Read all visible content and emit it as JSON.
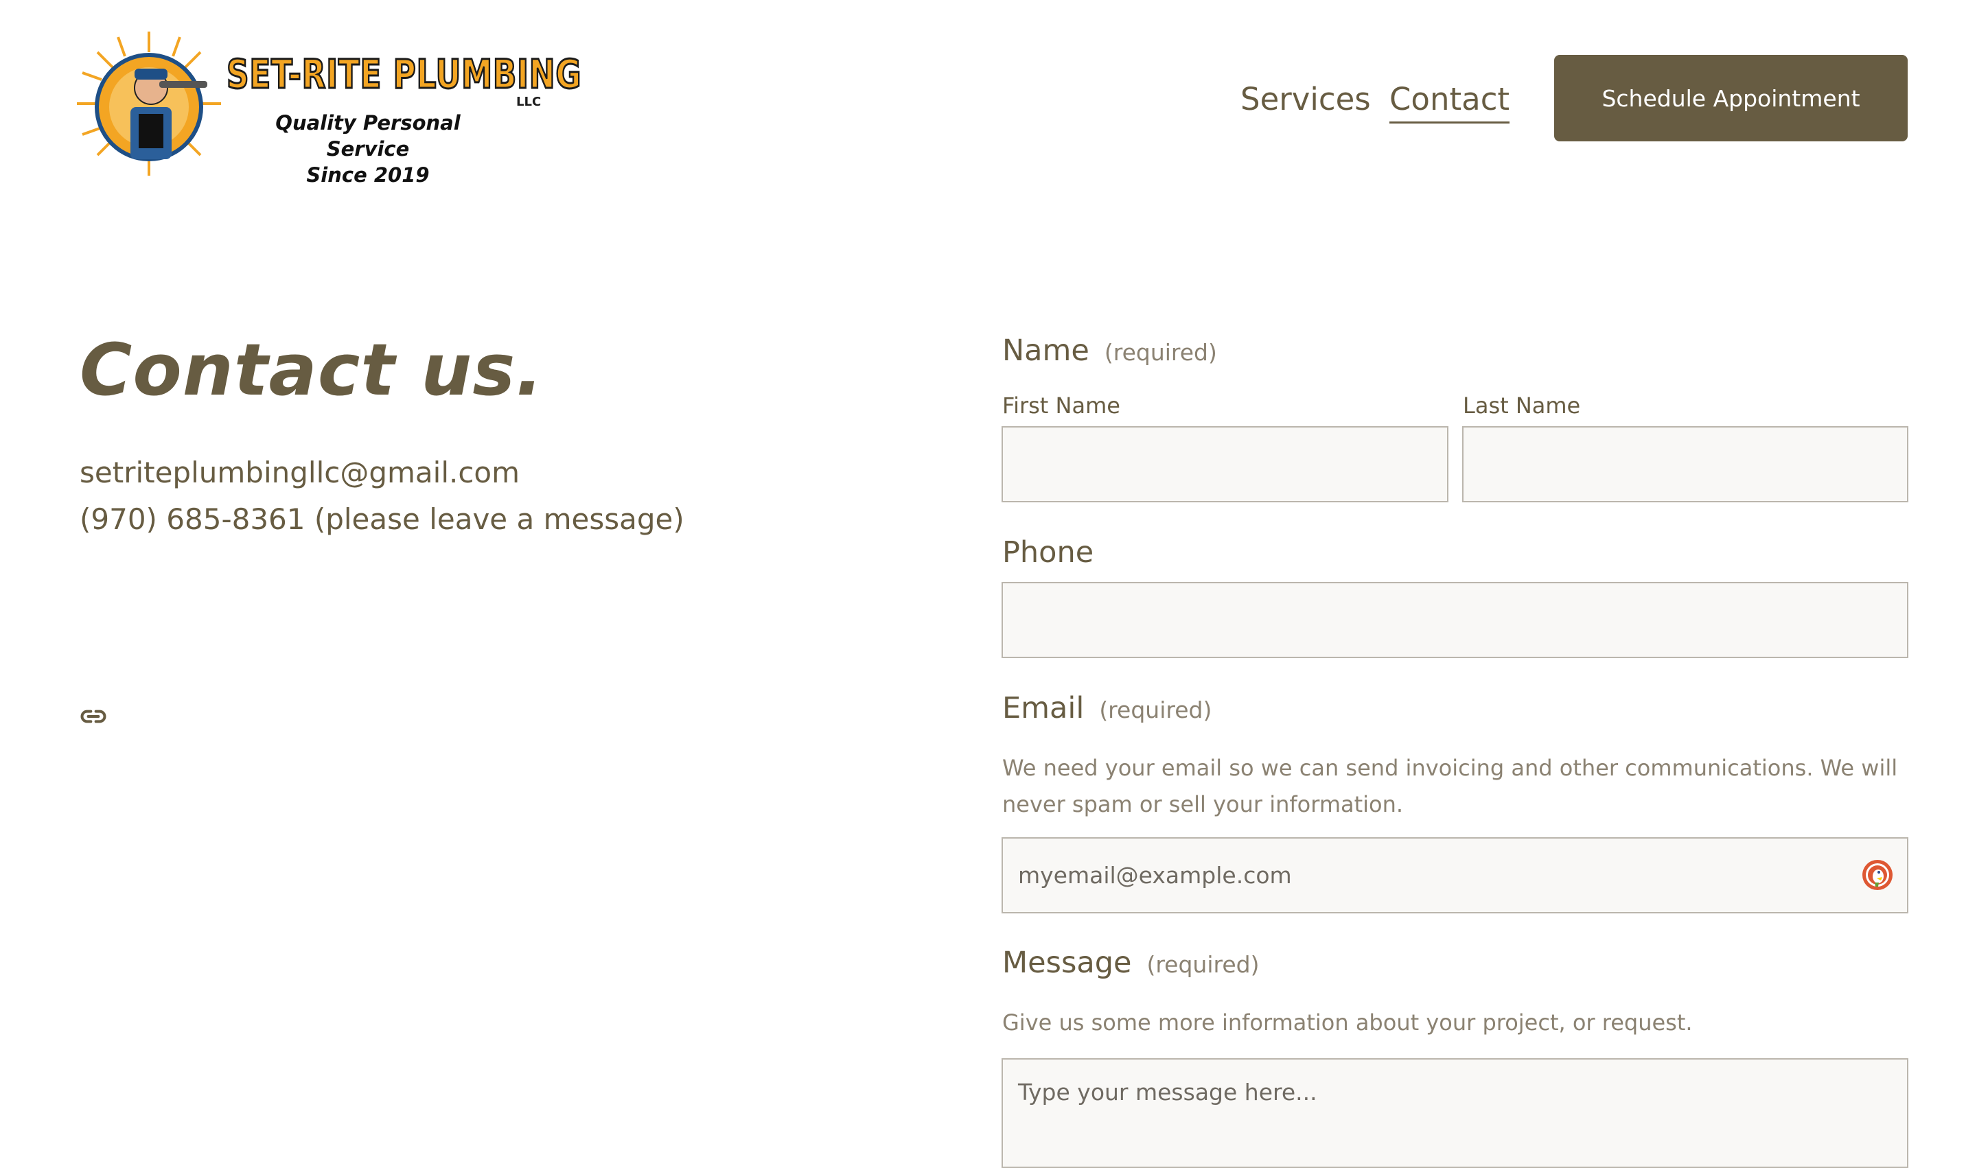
{
  "header": {
    "logo": {
      "brand": "SET-RITE PLUMBING",
      "suffix": "LLC",
      "tagline_line1": "Quality Personal Service",
      "tagline_line2": "Since 2019"
    },
    "nav": [
      {
        "label": "Services"
      },
      {
        "label": "Contact"
      }
    ],
    "cta_label": "Schedule Appointment"
  },
  "contact": {
    "title": "Contact us.",
    "email": "setriteplumbingllc@gmail.com",
    "phone": "(970) 685-8361 (please leave a message)"
  },
  "form": {
    "name": {
      "label": "Name",
      "required": "(required)",
      "first_label": "First Name",
      "last_label": "Last Name",
      "first_value": "",
      "last_value": ""
    },
    "phone": {
      "label": "Phone",
      "value": ""
    },
    "email": {
      "label": "Email",
      "required": "(required)",
      "help": "We need your email so we can send invoicing and other communications. We will never spam or sell your information.",
      "placeholder": "myemail@example.com",
      "value": ""
    },
    "message": {
      "label": "Message",
      "required": "(required)",
      "help": "Give us some more information about your project, or request.",
      "placeholder": "Type your message here...",
      "value": ""
    }
  },
  "colors": {
    "accent": "#675c42",
    "muted": "#8b8272",
    "input_bg": "#f9f8f6",
    "logo_orange": "#f3a523"
  },
  "icons": {
    "link": "link-icon",
    "email_autofill": "duckduckgo-icon"
  }
}
